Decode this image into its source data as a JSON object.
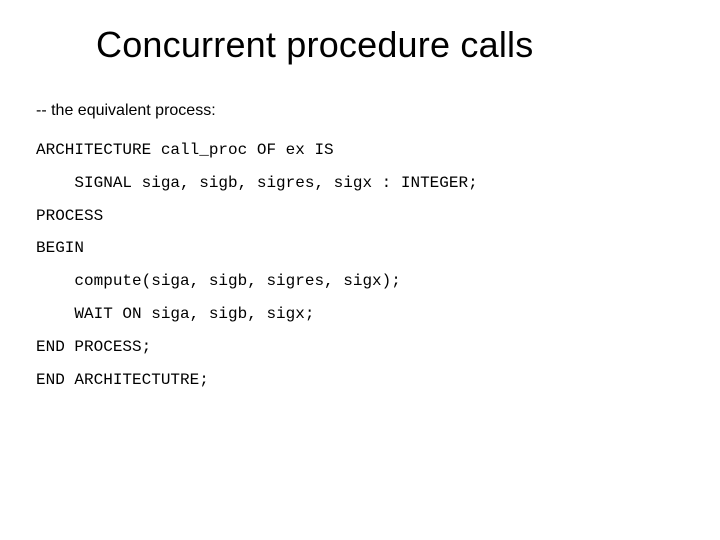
{
  "title": "Concurrent procedure calls",
  "comment": "-- the equivalent process:",
  "code": {
    "l1": "ARCHITECTURE call_proc OF ex IS",
    "l2": "    SIGNAL siga, sigb, sigres, sigx : INTEGER;",
    "l3": "PROCESS",
    "l4": "BEGIN",
    "l5": "    compute(siga, sigb, sigres, sigx);",
    "l6": "    WAIT ON siga, sigb, sigx;",
    "l7": "END PROCESS;",
    "l8": "END ARCHITECTUTRE;"
  }
}
